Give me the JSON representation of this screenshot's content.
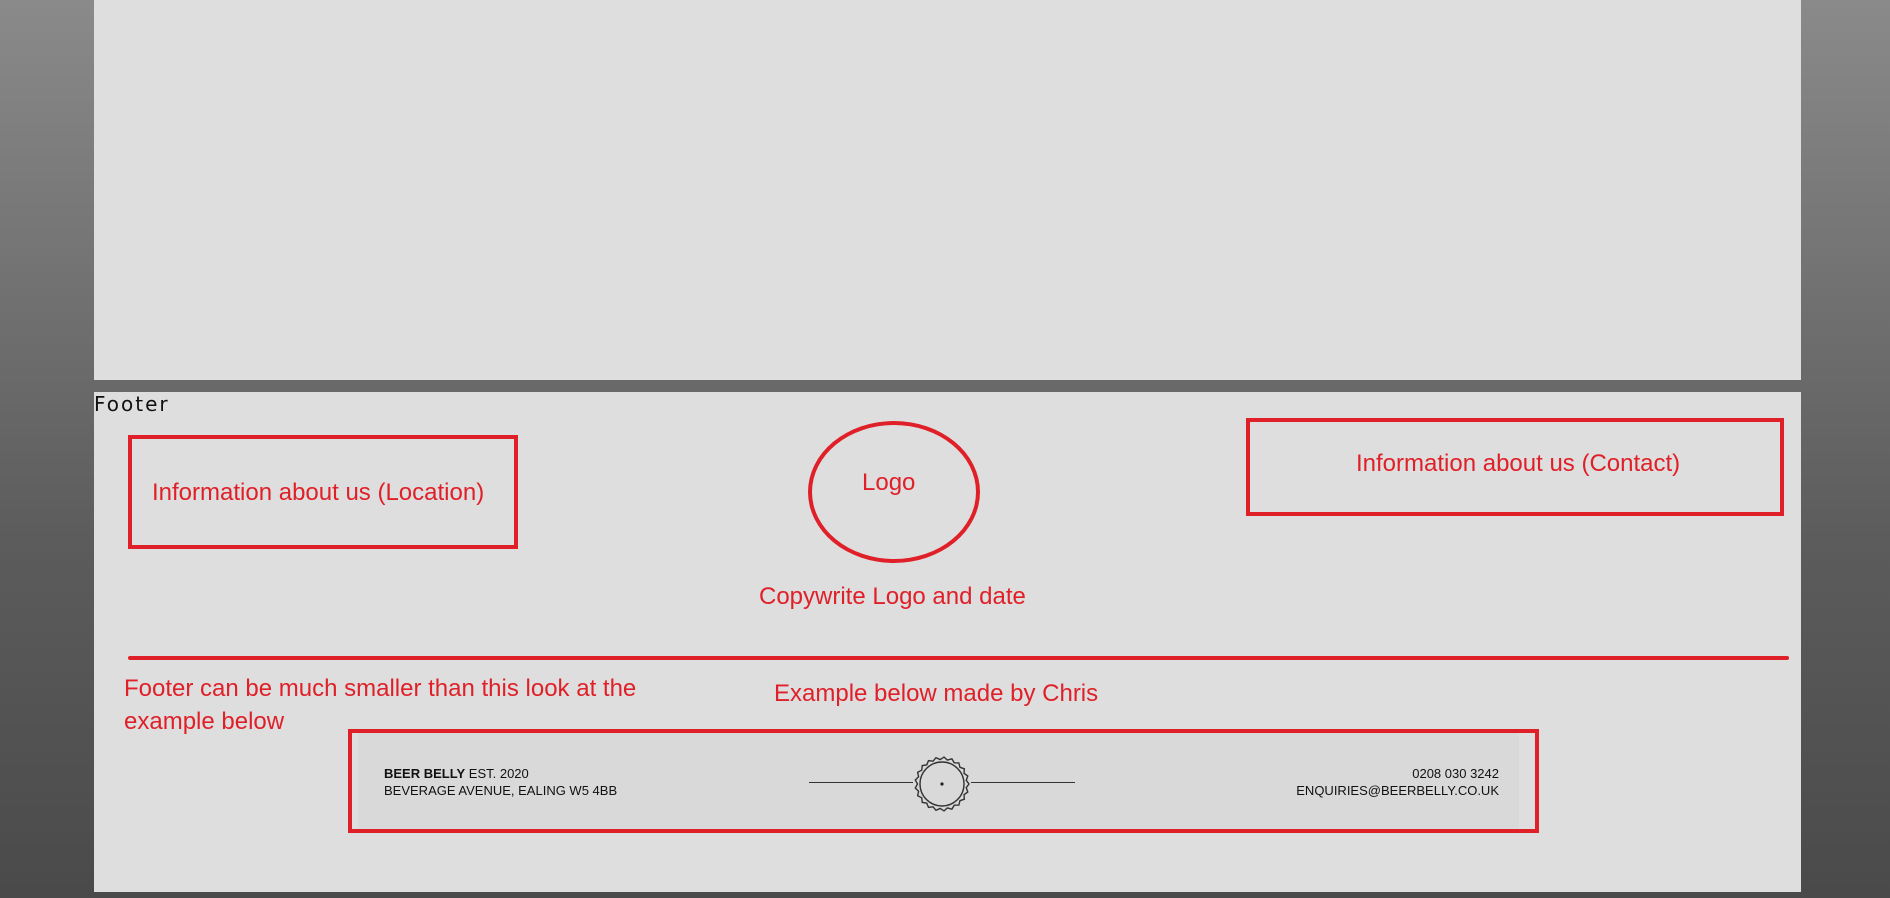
{
  "footer_label": "Footer",
  "annotations": {
    "location_box": "Information about us (Location)",
    "contact_box": "Information about us (Contact)",
    "logo": "Logo",
    "copyright": "Copywrite Logo and date",
    "note_left": "Footer can be much smaller than this look at the example below",
    "note_center": "Example below made by Chris"
  },
  "example_footer": {
    "brand": "BEER BELLY",
    "est": " EST. 2020",
    "address": "BEVERAGE AVENUE, EALING W5 4BB",
    "phone": "0208 030 3242",
    "email": "ENQUIRIES@BEERBELLY.CO.UK",
    "logo_icon": "bottle-cap-icon"
  },
  "colors": {
    "annotation_red": "#e02028",
    "panel": "#dedede",
    "background": "#5c5c5c"
  }
}
